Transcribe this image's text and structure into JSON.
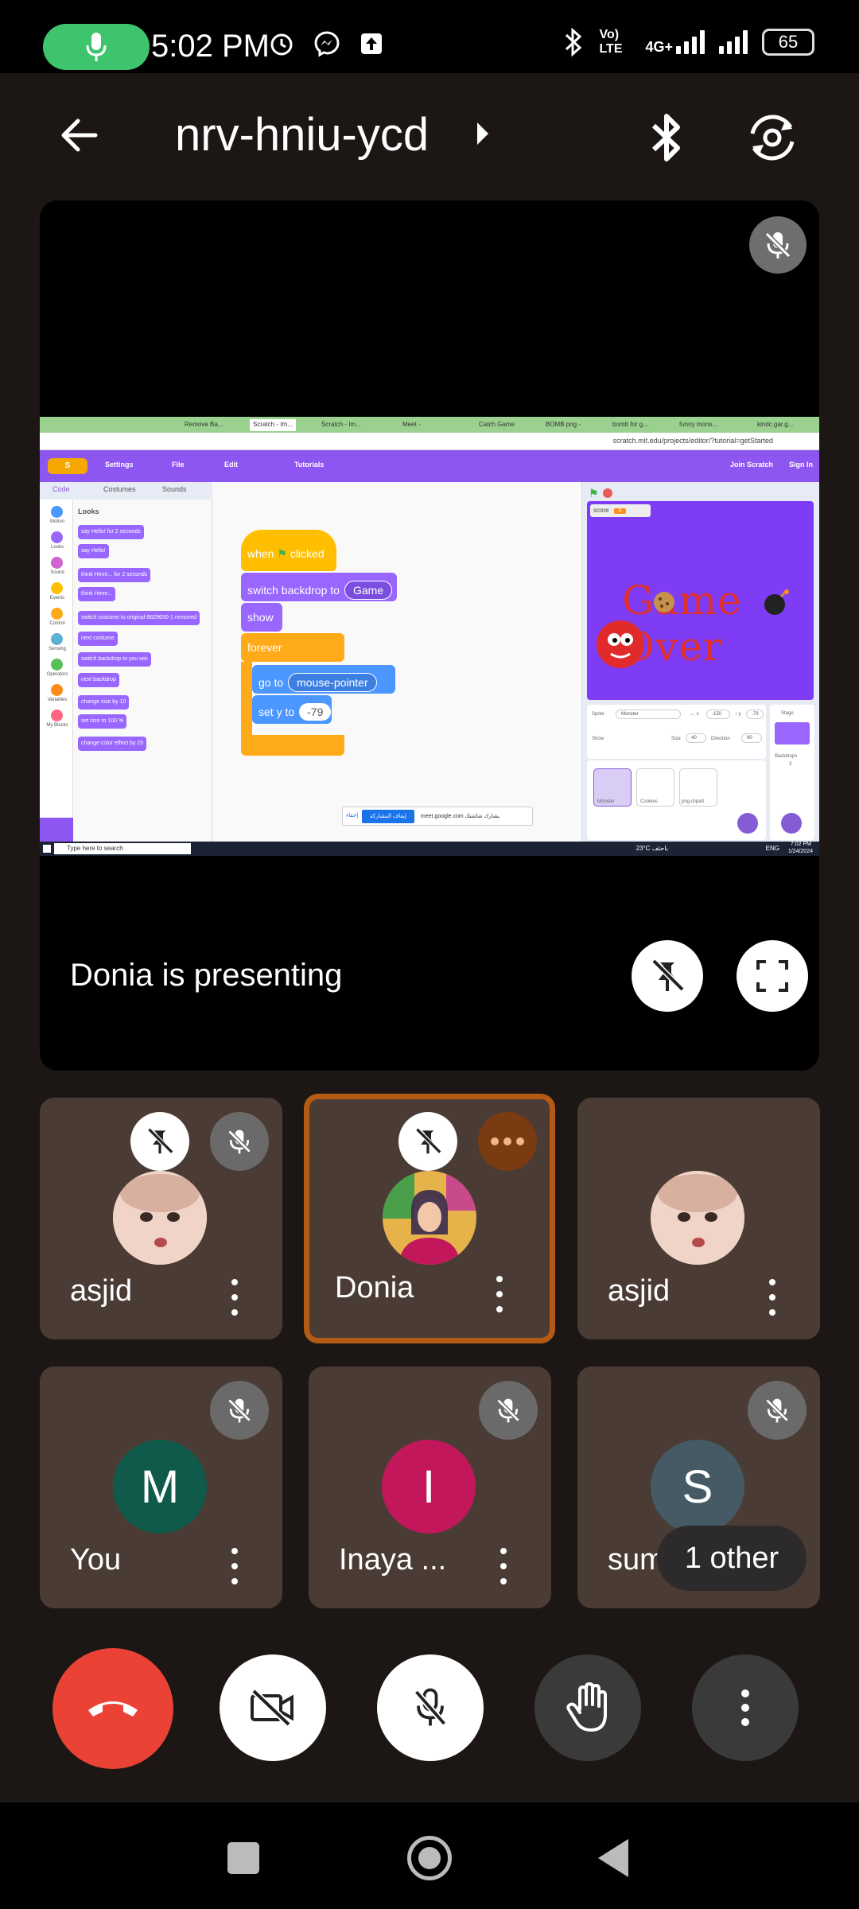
{
  "status_bar": {
    "time": "5:02 PM",
    "network_type": "4G+",
    "volte": "Vo) LTE",
    "battery": "65"
  },
  "header": {
    "meeting_code": "nrv-hniu-ycd"
  },
  "presentation": {
    "presenting_text": "Donia is presenting",
    "shared_screen": {
      "browser_tabs": [
        "Remove Ba...",
        "Scratch - Im...",
        "Scratch - Im...",
        "Meet -",
        "Catch Game",
        "BOMB png -",
        "bomb for g...",
        "funny mons...",
        "kindc.gar.g..."
      ],
      "url": "scratch.mit.edu/projects/editor/?tutorial=getStarted",
      "scratch_menu": [
        "Settings",
        "File",
        "Edit",
        "Tutorials"
      ],
      "scratch_right_menu": [
        "Join Scratch",
        "Sign In"
      ],
      "editor_tabs": [
        "Code",
        "Costumes",
        "Sounds"
      ],
      "categories": [
        {
          "label": "Motion",
          "color": "#4c97ff"
        },
        {
          "label": "Looks",
          "color": "#9966ff"
        },
        {
          "label": "Sound",
          "color": "#cf63cf"
        },
        {
          "label": "Events",
          "color": "#ffbf00"
        },
        {
          "label": "Control",
          "color": "#ffab19"
        },
        {
          "label": "Sensing",
          "color": "#5cb1d6"
        },
        {
          "label": "Operators",
          "color": "#59c059"
        },
        {
          "label": "Variables",
          "color": "#ff8c1a"
        },
        {
          "label": "My Blocks",
          "color": "#ff6680"
        }
      ],
      "palette_title": "Looks",
      "palette_blocks": [
        "say Hello! for 2 seconds",
        "say Hello!",
        "think Hmm... for 2 seconds",
        "think Hmm...",
        "switch costume to original-9829650-1 removed",
        "next costume",
        "switch backdrop to you win",
        "next backdrop",
        "change size by 10",
        "set size to 100 %",
        "change color effect by 25"
      ],
      "script": {
        "hat_when": "when",
        "hat_clicked": "clicked",
        "switch_backdrop": "switch backdrop to",
        "backdrop_value": "Game",
        "show": "show",
        "forever": "forever",
        "go_to": "go to",
        "go_to_value": "mouse-pointer",
        "set_y": "set y to",
        "set_y_value": "-79"
      },
      "stage": {
        "score_label": "score",
        "score_value": "0",
        "game_over_text": "Game Over"
      },
      "sprite_info": {
        "sprite_label": "Sprite",
        "sprite_name": "Monster",
        "x_value": "-150",
        "y_value": "-79",
        "show_label": "Show",
        "size_label": "Size",
        "size_value": "40",
        "direction_label": "Direction",
        "direction_value": "90"
      },
      "sprites": [
        "Monster",
        "Cookies",
        "png-clipart"
      ],
      "stage_pane": {
        "label": "Stage",
        "backdrops_label": "Backdrops",
        "backdrops_count": "3"
      },
      "meet_bar": {
        "stop_label": "إيقاف المشاركة",
        "hide_label": "إخفاء",
        "url_text": "meet.google.com يشارك شاشتك"
      },
      "taskbar": {
        "search_placeholder": "Type here to search",
        "weather": "23°C باحثف",
        "clock": "7:02 PM",
        "date": "1/24/2024",
        "lang": "ENG"
      }
    }
  },
  "participants": [
    {
      "name": "asjid",
      "avatar": "photo",
      "muted": true,
      "pinnable": true,
      "active": false
    },
    {
      "name": "Donia",
      "avatar": "photo",
      "muted": false,
      "pinnable": true,
      "active": true
    },
    {
      "name": "asjid",
      "avatar": "photo",
      "muted": false,
      "pinnable": false,
      "active": false
    },
    {
      "name": "You",
      "initial": "M",
      "avatar_color": "#0f5a4a",
      "muted": true
    },
    {
      "name": "Inaya ...",
      "initial": "I",
      "avatar_color": "#c2185b",
      "muted": true
    },
    {
      "name": "suma",
      "initial": "S",
      "avatar_color": "#455a64",
      "muted": true
    }
  ],
  "other_participants": "1 other",
  "controls": {
    "end_call_color": "#ea4335",
    "accent": "#b45a12"
  }
}
